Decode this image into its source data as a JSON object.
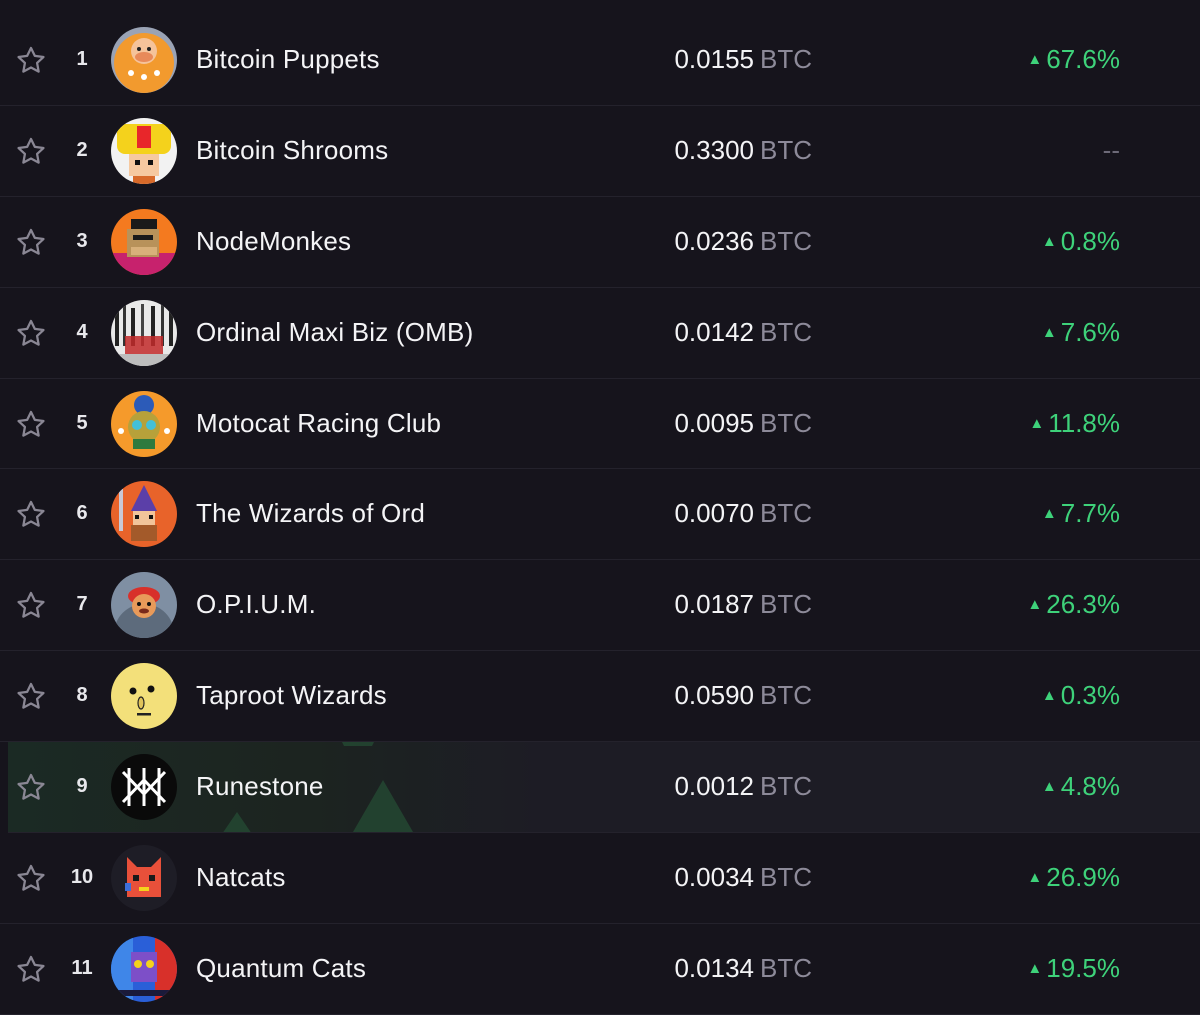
{
  "unit": "BTC",
  "colors": {
    "background": "#16141c",
    "positive": "#3ed27a",
    "unit_text": "#8d8a99",
    "highlight_row": "#1d1c25"
  },
  "rows": [
    {
      "rank": "1",
      "name": "Bitcoin Puppets",
      "price": "0.0155",
      "change": "67.6%",
      "trend": "up",
      "avatar": "bitcoin-puppets-avatar"
    },
    {
      "rank": "2",
      "name": "Bitcoin Shrooms",
      "price": "0.3300",
      "change": "--",
      "trend": "none",
      "avatar": "bitcoin-shrooms-avatar"
    },
    {
      "rank": "3",
      "name": "NodeMonkes",
      "price": "0.0236",
      "change": "0.8%",
      "trend": "up",
      "avatar": "nodemonkes-avatar"
    },
    {
      "rank": "4",
      "name": "Ordinal Maxi Biz (OMB)",
      "price": "0.0142",
      "change": "7.6%",
      "trend": "up",
      "avatar": "omb-avatar"
    },
    {
      "rank": "5",
      "name": "Motocat Racing Club",
      "price": "0.0095",
      "change": "11.8%",
      "trend": "up",
      "avatar": "motocat-avatar"
    },
    {
      "rank": "6",
      "name": "The Wizards of Ord",
      "price": "0.0070",
      "change": "7.7%",
      "trend": "up",
      "avatar": "wizards-of-ord-avatar"
    },
    {
      "rank": "7",
      "name": "O.P.I.U.M.",
      "price": "0.0187",
      "change": "26.3%",
      "trend": "up",
      "avatar": "opium-avatar"
    },
    {
      "rank": "8",
      "name": "Taproot Wizards",
      "price": "0.0590",
      "change": "0.3%",
      "trend": "up",
      "avatar": "taproot-wizards-avatar"
    },
    {
      "rank": "9",
      "name": "Runestone",
      "price": "0.0012",
      "change": "4.8%",
      "trend": "up",
      "avatar": "runestone-avatar",
      "highlighted": true
    },
    {
      "rank": "10",
      "name": "Natcats",
      "price": "0.0034",
      "change": "26.9%",
      "trend": "up",
      "avatar": "natcats-avatar"
    },
    {
      "rank": "11",
      "name": "Quantum Cats",
      "price": "0.0134",
      "change": "19.5%",
      "trend": "up",
      "avatar": "quantum-cats-avatar"
    }
  ]
}
